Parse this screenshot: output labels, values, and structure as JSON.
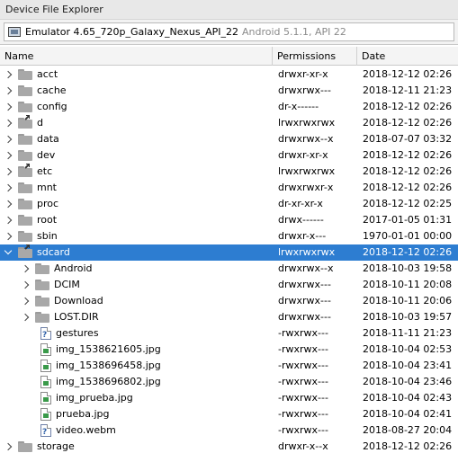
{
  "window": {
    "title": "Device File Explorer"
  },
  "device": {
    "name": "Emulator 4.65_720p_Galaxy_Nexus_API_22",
    "version": "Android 5.1.1, API 22"
  },
  "columns": {
    "name": "Name",
    "permissions": "Permissions",
    "date": "Date"
  },
  "rows": [
    {
      "name": "acct",
      "perm": "drwxr-xr-x",
      "date": "2018-12-12 02:26"
    },
    {
      "name": "cache",
      "perm": "drwxrwx---",
      "date": "2018-12-11 21:23"
    },
    {
      "name": "config",
      "perm": "dr-x------",
      "date": "2018-12-12 02:26"
    },
    {
      "name": "d",
      "perm": "lrwxrwxrwx",
      "date": "2018-12-12 02:26"
    },
    {
      "name": "data",
      "perm": "drwxrwx--x",
      "date": "2018-07-07 03:32"
    },
    {
      "name": "dev",
      "perm": "drwxr-xr-x",
      "date": "2018-12-12 02:26"
    },
    {
      "name": "etc",
      "perm": "lrwxrwxrwx",
      "date": "2018-12-12 02:26"
    },
    {
      "name": "mnt",
      "perm": "drwxrwxr-x",
      "date": "2018-12-12 02:26"
    },
    {
      "name": "proc",
      "perm": "dr-xr-xr-x",
      "date": "2018-12-12 02:25"
    },
    {
      "name": "root",
      "perm": "drwx------",
      "date": "2017-01-05 01:31"
    },
    {
      "name": "sbin",
      "perm": "drwxr-x---",
      "date": "1970-01-01 00:00"
    },
    {
      "name": "sdcard",
      "perm": "lrwxrwxrwx",
      "date": "2018-12-12 02:26"
    },
    {
      "name": "Android",
      "perm": "drwxrwx--x",
      "date": "2018-10-03 19:58"
    },
    {
      "name": "DCIM",
      "perm": "drwxrwx---",
      "date": "2018-10-11 20:08"
    },
    {
      "name": "Download",
      "perm": "drwxrwx---",
      "date": "2018-10-11 20:06"
    },
    {
      "name": "LOST.DIR",
      "perm": "drwxrwx---",
      "date": "2018-10-03 19:57"
    },
    {
      "name": "gestures",
      "perm": "-rwxrwx---",
      "date": "2018-11-11 21:23"
    },
    {
      "name": "img_1538621605.jpg",
      "perm": "-rwxrwx---",
      "date": "2018-10-04 02:53"
    },
    {
      "name": "img_1538696458.jpg",
      "perm": "-rwxrwx---",
      "date": "2018-10-04 23:41"
    },
    {
      "name": "img_1538696802.jpg",
      "perm": "-rwxrwx---",
      "date": "2018-10-04 23:46"
    },
    {
      "name": "img_prueba.jpg",
      "perm": "-rwxrwx---",
      "date": "2018-10-04 02:43"
    },
    {
      "name": "prueba.jpg",
      "perm": "-rwxrwx---",
      "date": "2018-10-04 02:41"
    },
    {
      "name": "video.webm",
      "perm": "-rwxrwx---",
      "date": "2018-08-27 20:04"
    },
    {
      "name": "storage",
      "perm": "drwxr-x--x",
      "date": "2018-12-12 02:26"
    }
  ]
}
